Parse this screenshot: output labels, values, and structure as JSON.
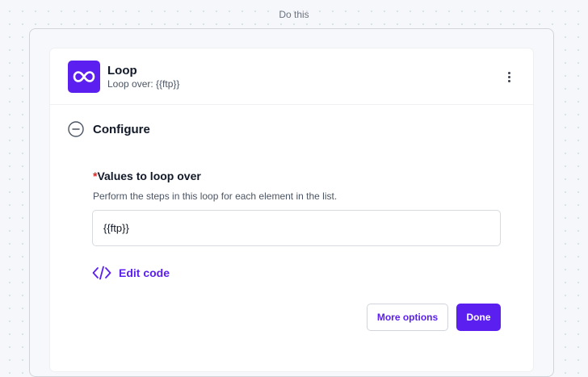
{
  "section_label": "Do this",
  "step": {
    "app_icon": "infinity-loop-icon",
    "title": "Loop",
    "subtitle": "Loop over: {{ftp}}",
    "menu_icon": "more-vertical-icon"
  },
  "configure": {
    "icon": "collapse-minus-circle-icon",
    "label": "Configure"
  },
  "field": {
    "required_marker": "*",
    "label": "Values to loop over",
    "help": "Perform the steps in this loop for each element in the list.",
    "value": "{{ftp}}"
  },
  "edit_code": {
    "icon": "code-icon",
    "label": "Edit code"
  },
  "actions": {
    "more_options": "More options",
    "done": "Done"
  },
  "colors": {
    "accent": "#5b1ff0",
    "required": "#dc2626",
    "canvas": "#f5f7fa"
  }
}
